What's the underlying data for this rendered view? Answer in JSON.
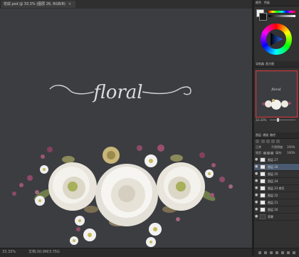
{
  "document": {
    "tab_title": "花纹.psd @ 33.3% (图层 26, RGB/8)",
    "close_label": "×",
    "title_text": "floral",
    "zoom": "33.33%",
    "doc_info": "文档:30.0M/3.75G"
  },
  "panels": {
    "color_tabs": [
      "颜色",
      "色板"
    ],
    "nav_tabs": [
      "导航器",
      "直方图"
    ],
    "nav_zoom": "33.33%",
    "nav_title_text": "floral",
    "layer_tabs": [
      "图层",
      "通道",
      "路径"
    ],
    "blend_mode": "正常",
    "opacity_label": "不透明度:",
    "opacity_value": "100%",
    "lock_label": "锁定:",
    "fill_label": "填充:",
    "fill_value": "100%",
    "layers": [
      {
        "name": "图层 27"
      },
      {
        "name": "图层 26"
      },
      {
        "name": "图层 25"
      },
      {
        "name": "图层 24"
      },
      {
        "name": "图层 23 拷贝"
      },
      {
        "name": "图层 22"
      },
      {
        "name": "图层 21"
      },
      {
        "name": "图层 20"
      },
      {
        "name": "背景"
      }
    ]
  },
  "colors": {
    "canvas_bg": "#3c3d41",
    "nav_frame": "#e0393e",
    "foreground": "#f0f0f0",
    "background": "#1a1a1a"
  },
  "icons": {
    "eye": "eye-icon",
    "document": "document-icon",
    "lock": "lock-icon"
  }
}
